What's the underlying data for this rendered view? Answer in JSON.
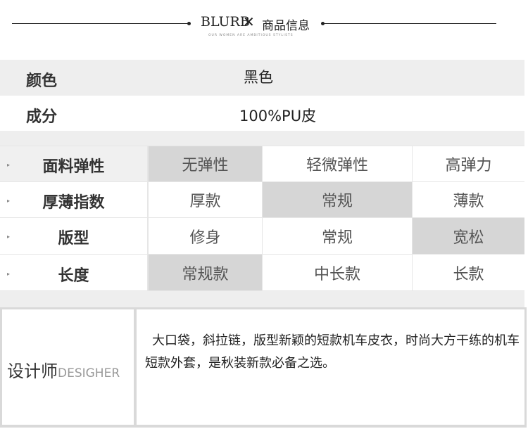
{
  "header": {
    "brand": "BLURB",
    "separator": "✕",
    "title": "商品信息",
    "subtitle": "OUR WOMEN ARE AMBITIOUS STYLISTS"
  },
  "info": [
    {
      "label": "颜色",
      "value": "黑色"
    },
    {
      "label": "成分",
      "value": "100%PU皮"
    }
  ],
  "attributes": [
    {
      "label": "面料弹性",
      "options": [
        "无弹性",
        "轻微弹性",
        "高弹力"
      ],
      "selected": 0
    },
    {
      "label": "厚薄指数",
      "options": [
        "厚款",
        "常规",
        "薄款"
      ],
      "selected": 1
    },
    {
      "label": "版型",
      "options": [
        "修身",
        "常规",
        "宽松"
      ],
      "selected": 2
    },
    {
      "label": "长度",
      "options": [
        "常规款",
        "中长款",
        "长款"
      ],
      "selected": 0
    }
  ],
  "designer": {
    "label_cn": "设计师",
    "label_en": "DESIGHER",
    "description": "大口袋，斜拉链，版型新颖的短款机车皮衣，时尚大方干练的机车短款外套，是秋装新款必备之选。"
  }
}
